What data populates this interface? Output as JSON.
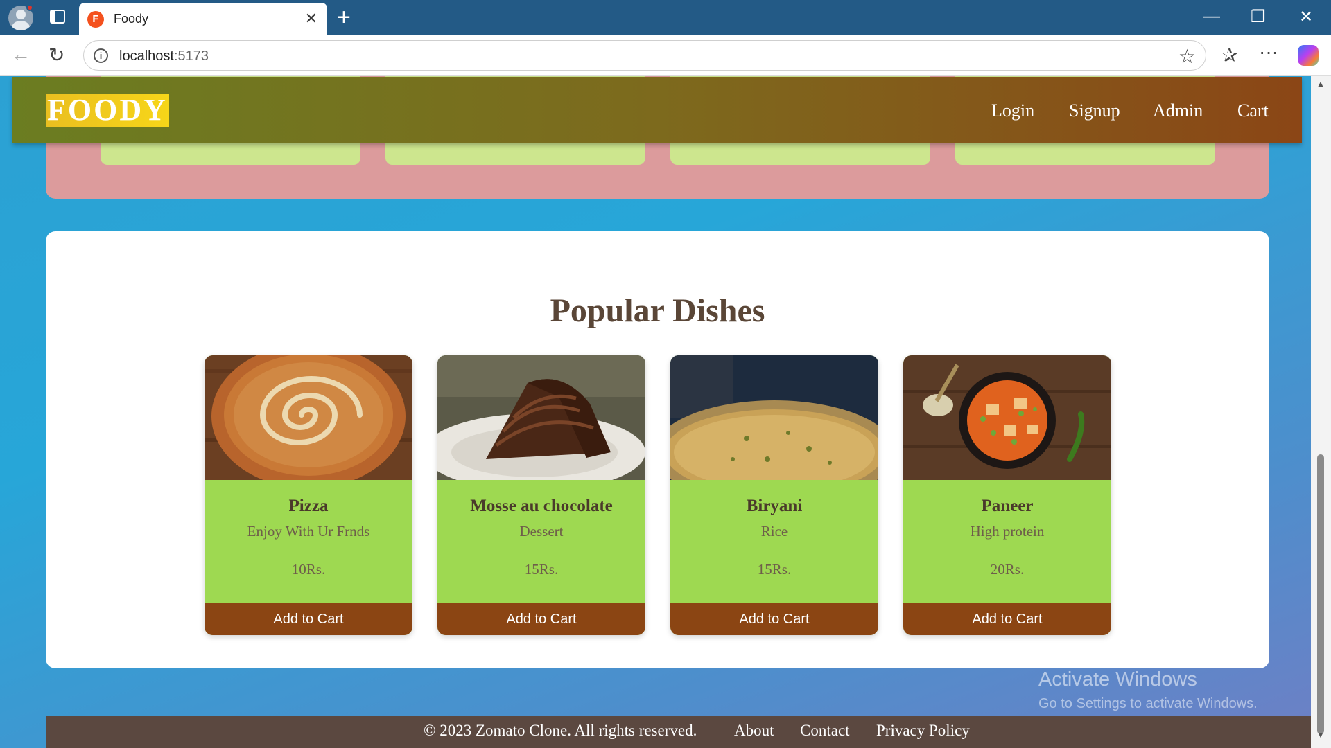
{
  "browser": {
    "tab_title": "Foody",
    "tab_favicon_letter": "F",
    "tab_close": "✕",
    "new_tab": "+",
    "url_host": "localhost",
    "url_port": ":5173",
    "info_icon": "i",
    "window_controls": {
      "minimize": "—",
      "restore": "❐",
      "close": "✕"
    },
    "nav_icons": {
      "back": "←",
      "reload": "↻",
      "favorites": "☆",
      "collections": "✰",
      "more": "···"
    }
  },
  "header": {
    "logo": "FOODY",
    "nav": [
      "Login",
      "Signup",
      "Admin",
      "Cart"
    ]
  },
  "popular": {
    "title": "Popular Dishes",
    "dishes": [
      {
        "name": "Pizza",
        "description": "Enjoy With Ur Frnds",
        "price": "10Rs.",
        "button": "Add to Cart"
      },
      {
        "name": "Mosse au chocolate",
        "description": "Dessert",
        "price": "15Rs.",
        "button": "Add to Cart"
      },
      {
        "name": "Biryani",
        "description": "Rice",
        "price": "15Rs.",
        "button": "Add to Cart"
      },
      {
        "name": "Paneer",
        "description": "High protein",
        "price": "20Rs.",
        "button": "Add to Cart"
      }
    ]
  },
  "watermark": {
    "line1": "Activate Windows",
    "line2": "Go to Settings to activate Windows."
  },
  "footer": {
    "copyright": "© 2023 Zomato Clone. All rights reserved.",
    "links": [
      "About",
      "Contact",
      "Privacy Policy"
    ]
  },
  "scrollbar": {
    "up": "▲",
    "down": "▼"
  },
  "colors": {
    "header_gradient_start": "#6b7d21",
    "header_gradient_end": "#8b4616",
    "logo_bg": "#f0c419",
    "card_green": "#9ed951",
    "button_brown": "#8b4513",
    "footer_bg": "#5b4840",
    "page_blue": "#27a6d8",
    "pink_section": "#dc9b9c"
  }
}
